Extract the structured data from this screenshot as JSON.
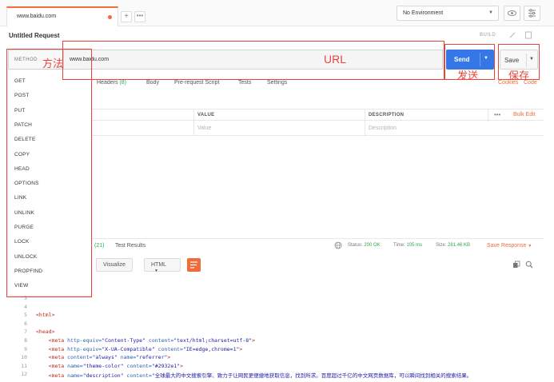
{
  "tab": {
    "label": "www.baidu.com",
    "add": "+",
    "more": "•••"
  },
  "environment": {
    "selected": "No Environment"
  },
  "request": {
    "title": "Untitled Request",
    "build": "BUILD",
    "method_label": "METHOD",
    "url": "www.baidu.com",
    "send_label": "Send",
    "save_label": "Save"
  },
  "subtabs": [
    {
      "label": "Headers",
      "badge": "(8)"
    },
    {
      "label": "Body"
    },
    {
      "label": "Pre-request Script"
    },
    {
      "label": "Tests"
    },
    {
      "label": "Settings"
    }
  ],
  "links": {
    "cookies": "Cookies",
    "code": "Code",
    "bulk_edit": "Bulk Edit"
  },
  "params": {
    "headers": [
      "VALUE",
      "DESCRIPTION"
    ],
    "value_placeholder": "Value",
    "description_placeholder": "Description"
  },
  "response": {
    "tab_badge": "(21)",
    "test_results": "Test Results",
    "status_label": "Status:",
    "status_value": "200 OK",
    "time_label": "Time:",
    "time_value": "105 ms",
    "size_label": "Size:",
    "size_value": "281.46 KB",
    "save_response": "Save Response",
    "visualize": "Visualize",
    "format": "HTML"
  },
  "code_lines": [
    {
      "n": "3",
      "html": ""
    },
    {
      "n": "4",
      "html": ""
    },
    {
      "n": "5",
      "html": "<span class=\"tag\">&lt;html&gt;</span>"
    },
    {
      "n": "6",
      "html": ""
    },
    {
      "n": "7",
      "html": "<span class=\"tag\">&lt;head&gt;</span>"
    },
    {
      "n": "8",
      "html": "    <span class=\"tag\">&lt;meta</span> <span class=\"attr\">http-equiv=</span><span class=\"str\">\"Content-Type\"</span> <span class=\"attr\">content=</span><span class=\"str\">\"text/html;charset=utf-8\"</span><span class=\"tag\">&gt;</span>"
    },
    {
      "n": "9",
      "html": "    <span class=\"tag\">&lt;meta</span> <span class=\"attr\">http-equiv=</span><span class=\"str\">\"X-UA-Compatible\"</span> <span class=\"attr\">content=</span><span class=\"str\">\"IE=edge,chrome=1\"</span><span class=\"tag\">&gt;</span>"
    },
    {
      "n": "10",
      "html": "    <span class=\"tag\">&lt;meta</span> <span class=\"attr\">content=</span><span class=\"str\">\"always\"</span> <span class=\"attr\">name=</span><span class=\"str\">\"referrer\"</span><span class=\"tag\">&gt;</span>"
    },
    {
      "n": "11",
      "html": "    <span class=\"tag\">&lt;meta</span> <span class=\"attr\">name=</span><span class=\"str\">\"theme-color\"</span> <span class=\"attr\">content=</span><span class=\"str\">\"#2932e1\"</span><span class=\"tag\">&gt;</span>"
    },
    {
      "n": "12",
      "html": "    <span class=\"tag\">&lt;meta</span> <span class=\"attr\">name=</span><span class=\"str\">\"description\"</span> <span class=\"attr\">content=</span><span class=\"str\">\"全球最大的中文搜索引擎、致力于让网民更便捷地获取信息，找到所求。百度超过千亿的中文网页数据库，可以瞬间找到相关的搜索结果。</span>"
    }
  ],
  "methods": [
    "GET",
    "POST",
    "PUT",
    "PATCH",
    "DELETE",
    "COPY",
    "HEAD",
    "OPTIONS",
    "LINK",
    "UNLINK",
    "PURGE",
    "LOCK",
    "UNLOCK",
    "PROPFIND",
    "VIEW"
  ],
  "annotations": {
    "method": "方法",
    "url": "URL",
    "send": "发送",
    "save": "保存"
  },
  "colors": {
    "accent": "#f26b3a",
    "send": "#3577e6",
    "annotation": "#e8443a",
    "ok": "#2fa84f"
  }
}
